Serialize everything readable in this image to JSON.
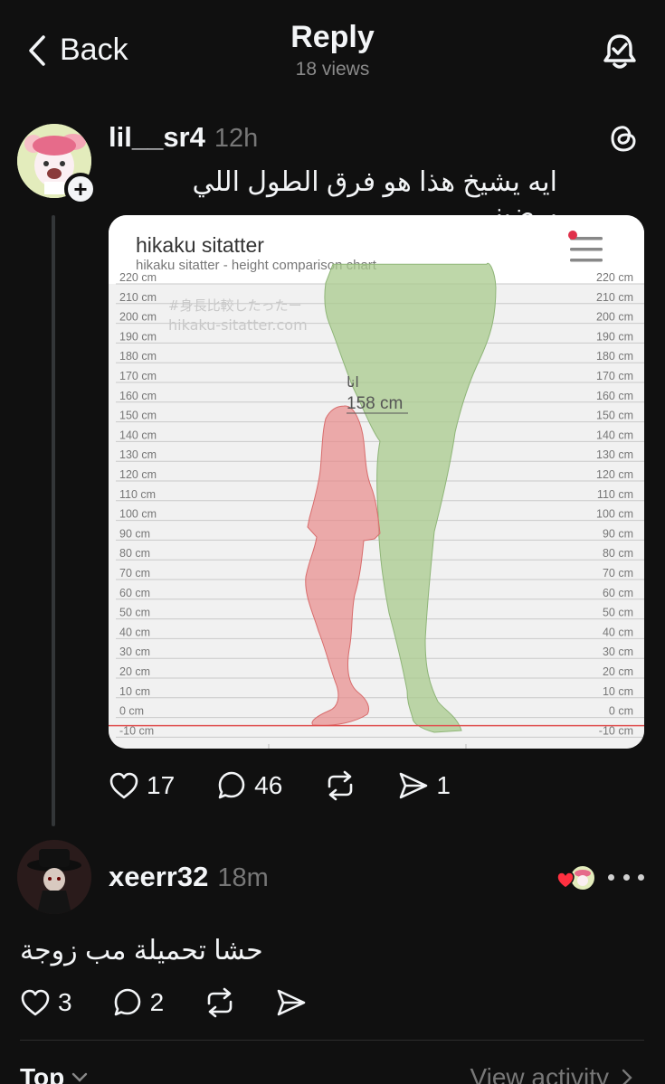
{
  "header": {
    "back_label": "Back",
    "title": "Reply",
    "views": "18 views"
  },
  "post": {
    "username": "lil__sr4",
    "time": "12h",
    "text": "ايه يشيخ هذا هو فرق الطول اللي يرضيني",
    "stats": {
      "likes": "17",
      "comments": "46",
      "shares": "1"
    }
  },
  "chart_card": {
    "title": "hikaku sitatter",
    "subtitle": "hikaku sitatter - height comparison chart",
    "watermark_jp": "#身長比較したったー",
    "watermark_url": "hikaku-sitatter.com",
    "figure_label_name": "انا",
    "figure_label_height": "158 cm",
    "colors": {
      "figure_red": "#e88a8a",
      "figure_green": "#a8c98c",
      "baseline": "#e05050"
    }
  },
  "chart_data": {
    "type": "height-comparison",
    "y_unit": "cm",
    "ylim": [
      -10,
      220
    ],
    "ticks": [
      "220 cm",
      "210 cm",
      "200 cm",
      "190 cm",
      "180 cm",
      "170 cm",
      "160 cm",
      "150 cm",
      "140 cm",
      "130 cm",
      "120 cm",
      "110 cm",
      "100 cm",
      "90 cm",
      "80 cm",
      "70 cm",
      "60 cm",
      "50 cm",
      "40 cm",
      "30 cm",
      "20 cm",
      "10 cm",
      "0 cm",
      "-10 cm"
    ],
    "figures": [
      {
        "label": "انا",
        "height_cm": 158,
        "color": "#e88a8a"
      },
      {
        "height_cm": 230,
        "color": "#a8c98c"
      }
    ]
  },
  "reply": {
    "username": "xeerr32",
    "time": "18m",
    "text": "حشا تحميلة مب زوجة",
    "stats": {
      "likes": "3",
      "comments": "2"
    }
  },
  "footer": {
    "sort_label": "Top",
    "activity_label": "View activity"
  }
}
